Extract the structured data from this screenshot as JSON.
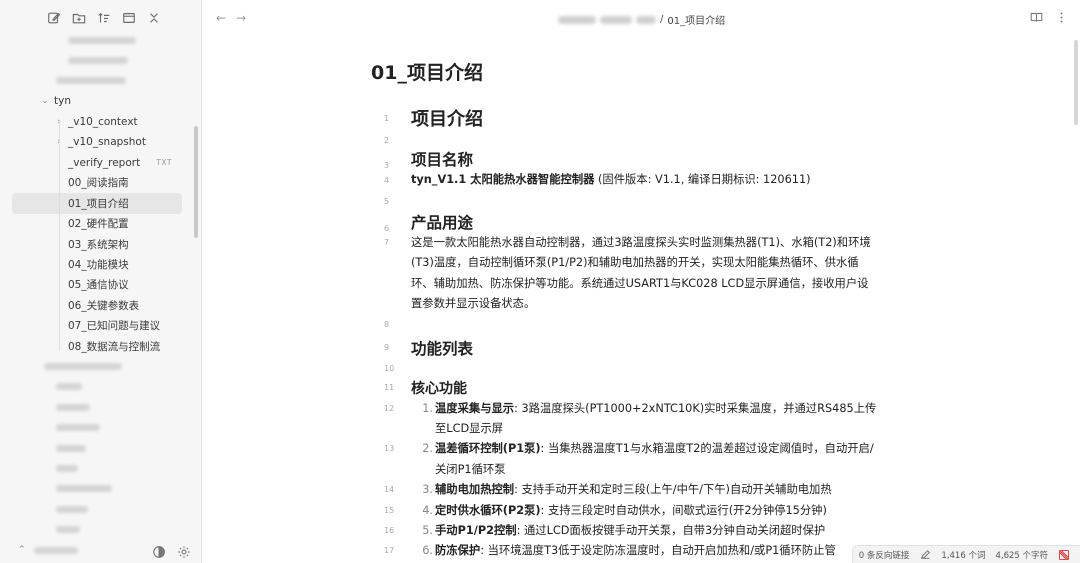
{
  "sidebar": {
    "toolbar": [
      "new-note-icon",
      "new-folder-icon",
      "sort-icon",
      "collapse-all-icon",
      "close-icon"
    ],
    "folder": "tyn",
    "items": [
      {
        "label": "_v10_context",
        "chevron": "›"
      },
      {
        "label": "_v10_snapshot",
        "chevron": "›"
      },
      {
        "label": "_verify_report",
        "badge": "TXT"
      },
      {
        "label": "00_阅读指南"
      },
      {
        "label": "01_项目介绍",
        "active": true
      },
      {
        "label": "02_硬件配置"
      },
      {
        "label": "03_系统架构"
      },
      {
        "label": "04_功能模块"
      },
      {
        "label": "05_通信协议"
      },
      {
        "label": "06_关键参数表"
      },
      {
        "label": "07_已知问题与建议"
      },
      {
        "label": "08_数据流与控制流"
      }
    ]
  },
  "topbar": {
    "back": "←",
    "forward": "→",
    "breadcrumb_sep": "/",
    "breadcrumb_current": "01_项目介绍"
  },
  "document": {
    "title": "01_项目介绍",
    "lines": {
      "l1": "项目介绍",
      "l3": "项目名称",
      "l4_bold": "tyn_V1.1 太阳能热水器智能控制器",
      "l4_rest": " (固件版本: V1.1, 编译日期标识: 120611)",
      "l6": "产品用途",
      "l7a": "这是一款太阳能热水器自动控制器，通过3路温度探头实时监测集热器(T1)、水箱(T2)和环境",
      "l7b": "(T3)温度，自动控制循环泵(P1/P2)和辅助电加热器的开关，实现太阳能集热循环、供水循",
      "l7c": "环、辅助加热、防冻保护等功能。系统通过USART1与KC028 LCD显示屏通信，接收用户设",
      "l7d": "置参数并显示设备状态。",
      "l9": "功能列表",
      "l11": "核心功能",
      "l12_num": "1.",
      "l12_bold": "温度采集与显示",
      "l12_a": ": 3路温度探头(PT1000+2xNTC10K)实时采集温度，并通过RS485上传",
      "l12_b": "至LCD显示屏",
      "l13_num": "2.",
      "l13_bold": "温差循环控制(P1泵)",
      "l13_a": ": 当集热器温度T1与水箱温度T2的温差超过设定阈值时，自动开启/",
      "l13_b": "关闭P1循环泵",
      "l14_num": "3.",
      "l14_bold": "辅助电加热控制",
      "l14_a": ": 支持手动开关和定时三段(上午/中午/下午)自动开关辅助电加热",
      "l15_num": "4.",
      "l15_bold": "定时供水循环(P2泵)",
      "l15_a": ": 支持三段定时自动供水，间歇式运行(开2分钟停15分钟)",
      "l16_num": "5.",
      "l16_bold": "手动P1/P2控制",
      "l16_a": ": 通过LCD面板按键手动开关泵，自带3分钟自动关闭超时保护",
      "l17_num": "6.",
      "l17_bold": "防冻保护",
      "l17_a": ": 当环境温度T3低于设定防冻温度时，自动开启加热和/或P1循环防止管"
    },
    "line_numbers": [
      "1",
      "2",
      "3",
      "4",
      "5",
      "6",
      "7",
      "8",
      "9",
      "10",
      "11",
      "12",
      "13",
      "14",
      "15",
      "16",
      "17"
    ]
  },
  "statusbar": {
    "backlinks": "0 条反向链接",
    "words": "1,416 个词",
    "chars": "4,625 个字符"
  },
  "colors": {
    "sync_error": "#d94b4b",
    "active_item": "#e6e6e6"
  }
}
